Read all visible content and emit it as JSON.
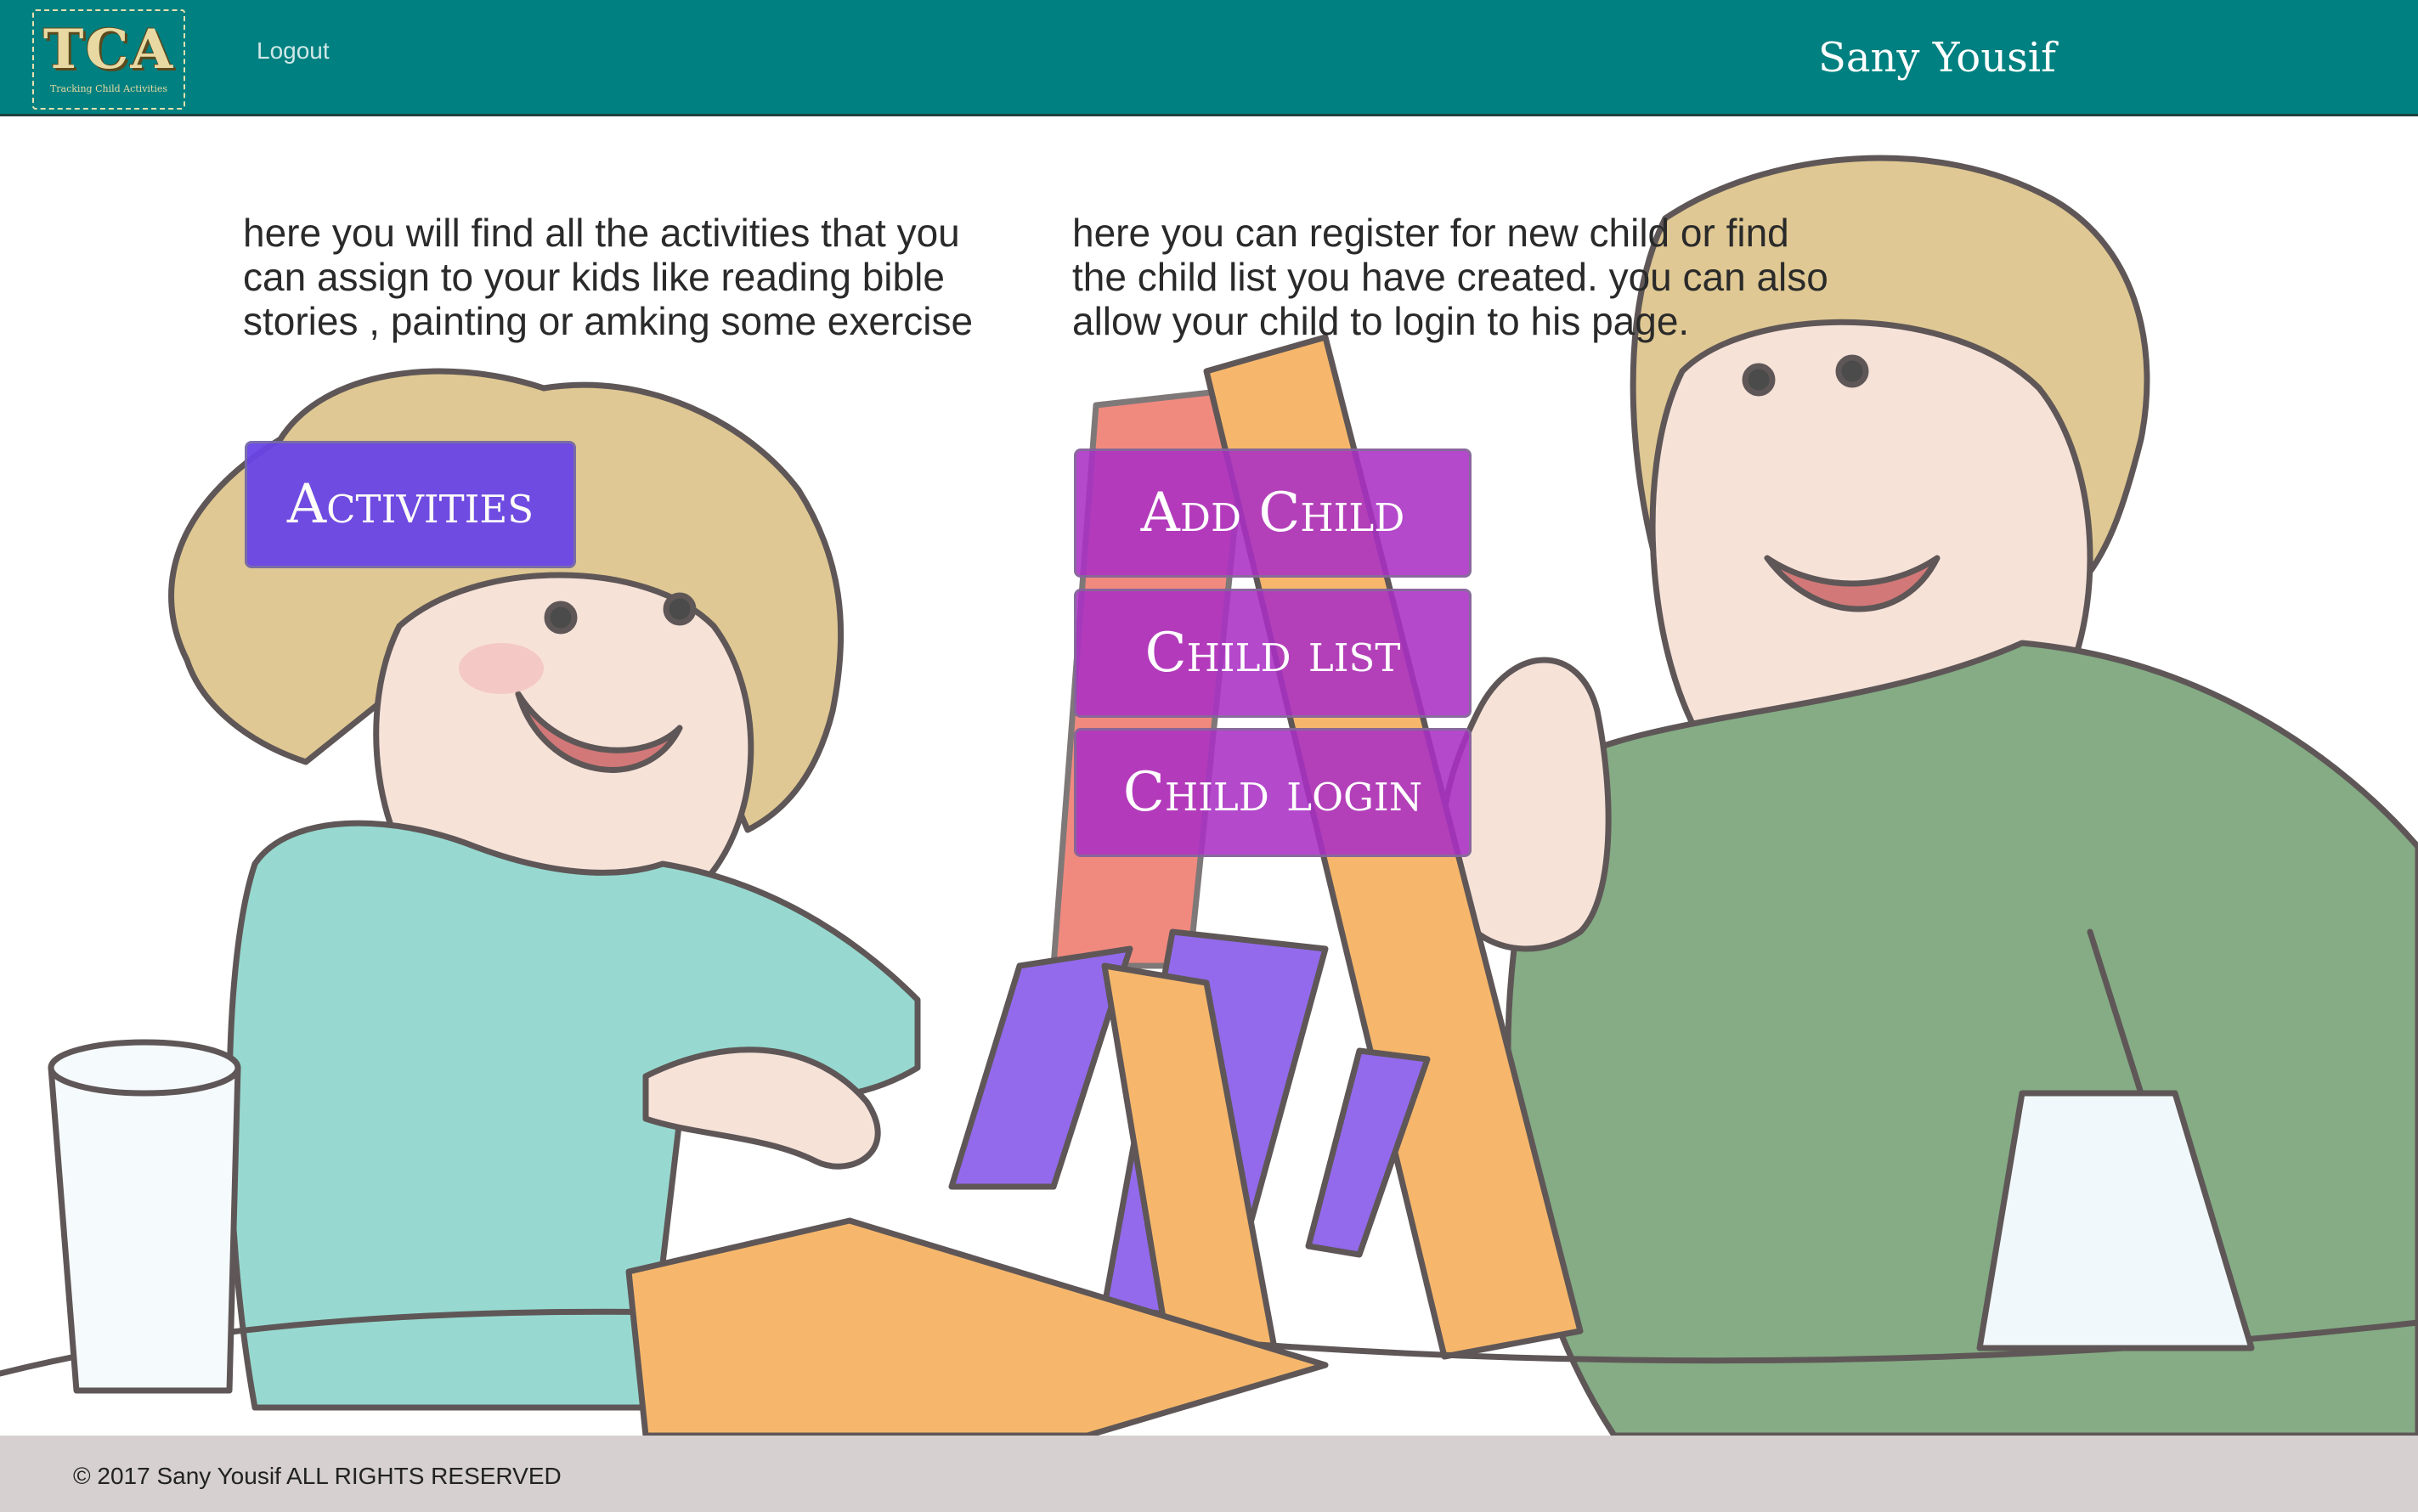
{
  "header": {
    "logo_text": "TCA",
    "logo_subtitle": "Tracking Child Activities",
    "logout_label": "Logout",
    "username": "Sany Yousif"
  },
  "main": {
    "activities_description": "here you will find all the activities that you can assign to your kids like reading bible stories , painting or amking some exercise",
    "child_description": "here you can register for new child or find the child list you have created. you can also allow your child to login to his page.",
    "activities_button": "Activities",
    "add_child_button": "Add Child",
    "child_list_button": "Child list",
    "child_login_button": "Child login"
  },
  "footer": {
    "copyright": "© 2017 Sany Yousif ALL RIGHTS RESERVED"
  },
  "colors": {
    "header_bg": "#008080",
    "footer_bg": "#d6d0d0",
    "activities_button": "#6a45e6",
    "child_buttons": "#aa30c4"
  }
}
